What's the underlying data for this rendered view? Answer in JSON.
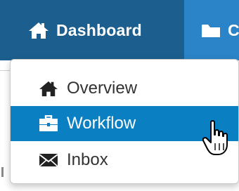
{
  "navbar": {
    "active_item": {
      "label": "Dashboard",
      "icon": "home-icon"
    },
    "next_item": {
      "label": "C",
      "icon": "folder-icon"
    },
    "colors": {
      "bar": "#2b84c7",
      "active": "#1c5f8e",
      "text": "#ffffff"
    }
  },
  "dropdown": {
    "items": [
      {
        "label": "Overview",
        "icon": "home-icon",
        "selected": false
      },
      {
        "label": "Workflow",
        "icon": "briefcase-icon",
        "selected": true
      },
      {
        "label": "Inbox",
        "icon": "envelope-icon",
        "selected": false
      }
    ],
    "colors": {
      "highlight": "#0a7fc2",
      "text": "#333333"
    }
  },
  "cursor": {
    "type": "hand-pointer"
  }
}
